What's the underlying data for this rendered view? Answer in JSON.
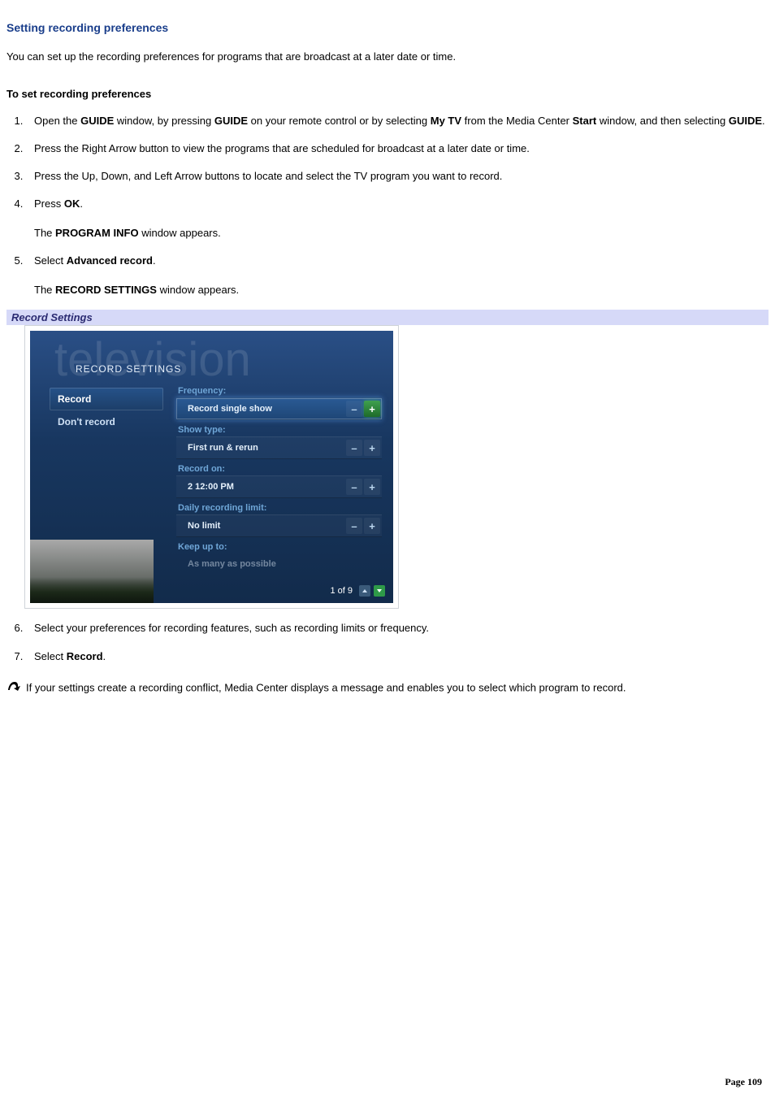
{
  "title": "Setting recording preferences",
  "intro": "You can set up the recording preferences for programs that are broadcast at a later date or time.",
  "sub_heading": "To set recording preferences",
  "steps": {
    "s1": {
      "t1": "Open the ",
      "b1": "GUIDE",
      "t2": " window, by pressing ",
      "b2": "GUIDE",
      "t3": " on your remote control or by selecting ",
      "b3": "My TV",
      "t4": " from the Media Center ",
      "b4": "Start",
      "t5": " window, and then selecting ",
      "b5": "GUIDE",
      "t6": "."
    },
    "s2": "Press the Right Arrow button to view the programs that are scheduled for broadcast at a later date or time.",
    "s3": "Press the Up, Down, and Left Arrow buttons to locate and select the TV program you want to record.",
    "s4": {
      "t1": "Press ",
      "b1": "OK",
      "t2": ".",
      "f1a": "The ",
      "f1b": "PROGRAM INFO",
      "f1c": " window appears."
    },
    "s5": {
      "t1": "Select ",
      "b1": "Advanced record",
      "t2": ".",
      "f1a": "The ",
      "f1b": "RECORD SETTINGS",
      "f1c": " window appears."
    },
    "s6": "Select your preferences for recording features, such as recording limits or frequency.",
    "s7": {
      "t1": "Select ",
      "b1": "Record",
      "t2": "."
    }
  },
  "caption": "Record Settings",
  "mock": {
    "watermark": "television",
    "window_title": "RECORD SETTINGS",
    "side": {
      "record": "Record",
      "dont_record": "Don't record"
    },
    "settings": [
      {
        "label": "Frequency:",
        "value": "Record single show",
        "current": true
      },
      {
        "label": "Show type:",
        "value": "First run & rerun",
        "current": false
      },
      {
        "label": "Record on:",
        "value": "2  12:00 PM",
        "current": false
      },
      {
        "label": "Daily recording limit:",
        "value": "No limit",
        "current": false
      },
      {
        "label": "Keep up to:",
        "value": "As many as possible",
        "current": false,
        "dim": true
      }
    ],
    "pager": "1 of 9",
    "minus": "–",
    "plus": "+"
  },
  "note": "If your settings create a recording conflict, Media Center displays a message and enables you to select which program to record.",
  "footer": {
    "label": "Page ",
    "num": "109"
  }
}
